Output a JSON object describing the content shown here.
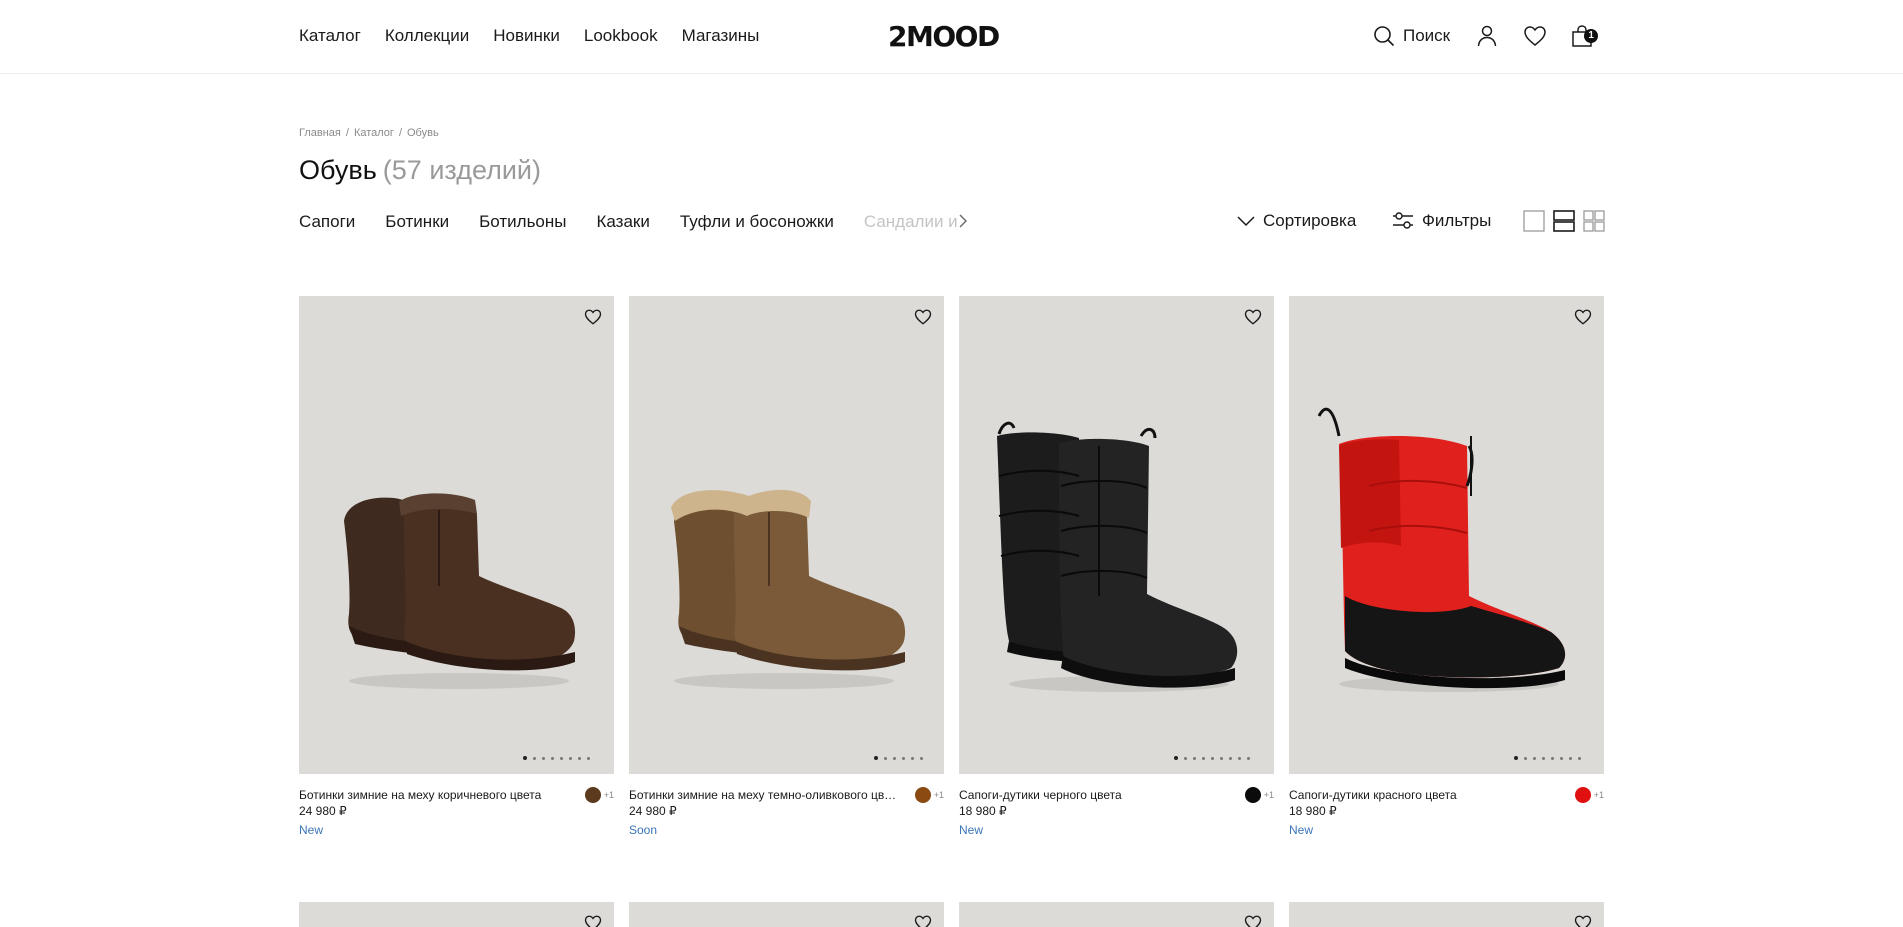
{
  "nav": {
    "items": [
      "Каталог",
      "Коллекции",
      "Новинки",
      "Lookbook",
      "Магазины"
    ],
    "logo": "2MOOD",
    "search_label": "Поиск",
    "cart_count": "1"
  },
  "breadcrumb": [
    "Главная",
    "/",
    "Каталог",
    "/",
    "Обувь"
  ],
  "page": {
    "title": "Обувь",
    "count": "(57 изделий)"
  },
  "categories": [
    "Сапоги",
    "Ботинки",
    "Ботильоны",
    "Казаки",
    "Туфли и босоножки",
    "Сандалии и"
  ],
  "toolbar": {
    "sort_label": "Сортировка",
    "filter_label": "Фильтры"
  },
  "products": [
    {
      "name": "Ботинки зимние на меху коричневого цвета",
      "price": "24 980 ₽",
      "badge": "New",
      "color": "#5b3a1e",
      "more": "+1",
      "image_dots": 8,
      "active_dot": 1
    },
    {
      "name": "Ботинки зимние на меху темно-оливкового цвета",
      "price": "24 980 ₽",
      "badge": "Soon",
      "color": "#8a4a12",
      "more": "+1",
      "image_dots": 6,
      "active_dot": 1
    },
    {
      "name": "Сапоги-дутики черного цвета",
      "price": "18 980 ₽",
      "badge": "New",
      "color": "#0b0b0b",
      "more": "+1",
      "image_dots": 9,
      "active_dot": 1
    },
    {
      "name": "Сапоги-дутики красного цвета",
      "price": "18 980 ₽",
      "badge": "New",
      "color": "#e01010",
      "more": "+1",
      "image_dots": 8,
      "active_dot": 1
    }
  ],
  "colors": {
    "badge_blue": "#3a74b8",
    "image_bg": "#dcdbd8"
  },
  "icons": [
    "search-icon",
    "user-icon",
    "heart-icon",
    "bag-icon",
    "chevron-right-icon",
    "chevron-down-icon",
    "sliders-icon",
    "view-single-icon",
    "view-double-icon",
    "view-grid-icon"
  ]
}
